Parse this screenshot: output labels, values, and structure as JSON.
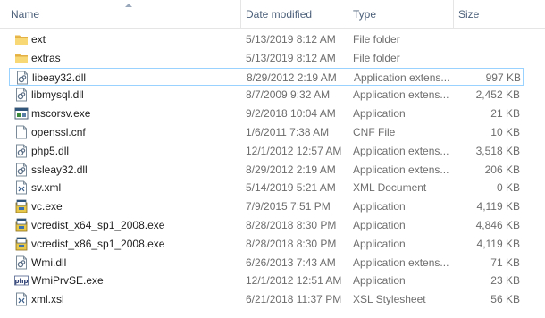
{
  "header": {
    "name": "Name",
    "date_modified": "Date modified",
    "type": "Type",
    "size": "Size"
  },
  "files": [
    {
      "name": "ext",
      "date": "5/13/2019 8:12 AM",
      "type": "File folder",
      "size": "",
      "icon": "folder-icon"
    },
    {
      "name": "extras",
      "date": "5/13/2019 8:12 AM",
      "type": "File folder",
      "size": "",
      "icon": "folder-icon"
    },
    {
      "name": "libeay32.dll",
      "date": "8/29/2012 2:19 AM",
      "type": "Application extens...",
      "size": "997 KB",
      "icon": "dll-icon",
      "selected": true
    },
    {
      "name": "libmysql.dll",
      "date": "8/7/2009 9:32 AM",
      "type": "Application extens...",
      "size": "2,452 KB",
      "icon": "dll-icon"
    },
    {
      "name": "mscorsv.exe",
      "date": "9/2/2018 10:04 AM",
      "type": "Application",
      "size": "21 KB",
      "icon": "exe-window-icon"
    },
    {
      "name": "openssl.cnf",
      "date": "1/6/2011 7:38 AM",
      "type": "CNF File",
      "size": "10 KB",
      "icon": "blank-file-icon"
    },
    {
      "name": "php5.dll",
      "date": "12/1/2012 12:57 AM",
      "type": "Application extens...",
      "size": "3,518 KB",
      "icon": "dll-icon"
    },
    {
      "name": "ssleay32.dll",
      "date": "8/29/2012 2:19 AM",
      "type": "Application extens...",
      "size": "206 KB",
      "icon": "dll-icon"
    },
    {
      "name": "sv.xml",
      "date": "5/14/2019 5:21 AM",
      "type": "XML Document",
      "size": "0 KB",
      "icon": "xml-file-icon"
    },
    {
      "name": "vc.exe",
      "date": "7/9/2015 7:51 PM",
      "type": "Application",
      "size": "4,119 KB",
      "icon": "installer-icon"
    },
    {
      "name": "vcredist_x64_sp1_2008.exe",
      "date": "8/28/2018 8:30 PM",
      "type": "Application",
      "size": "4,846 KB",
      "icon": "installer-icon"
    },
    {
      "name": "vcredist_x86_sp1_2008.exe",
      "date": "8/28/2018 8:30 PM",
      "type": "Application",
      "size": "4,119 KB",
      "icon": "installer-icon"
    },
    {
      "name": "Wmi.dll",
      "date": "6/26/2013 7:43 AM",
      "type": "Application extens...",
      "size": "71 KB",
      "icon": "dll-icon"
    },
    {
      "name": "WmiPrvSE.exe",
      "date": "12/1/2012 12:51 AM",
      "type": "Application",
      "size": "23 KB",
      "icon": "php-icon"
    },
    {
      "name": "xml.xsl",
      "date": "6/21/2018 11:37 PM",
      "type": "XSL Stylesheet",
      "size": "56 KB",
      "icon": "xml-file-icon"
    }
  ],
  "colors": {
    "header_text": "#4c607a",
    "folder": "#e8b84a",
    "selection_border": "#99d1ff"
  }
}
